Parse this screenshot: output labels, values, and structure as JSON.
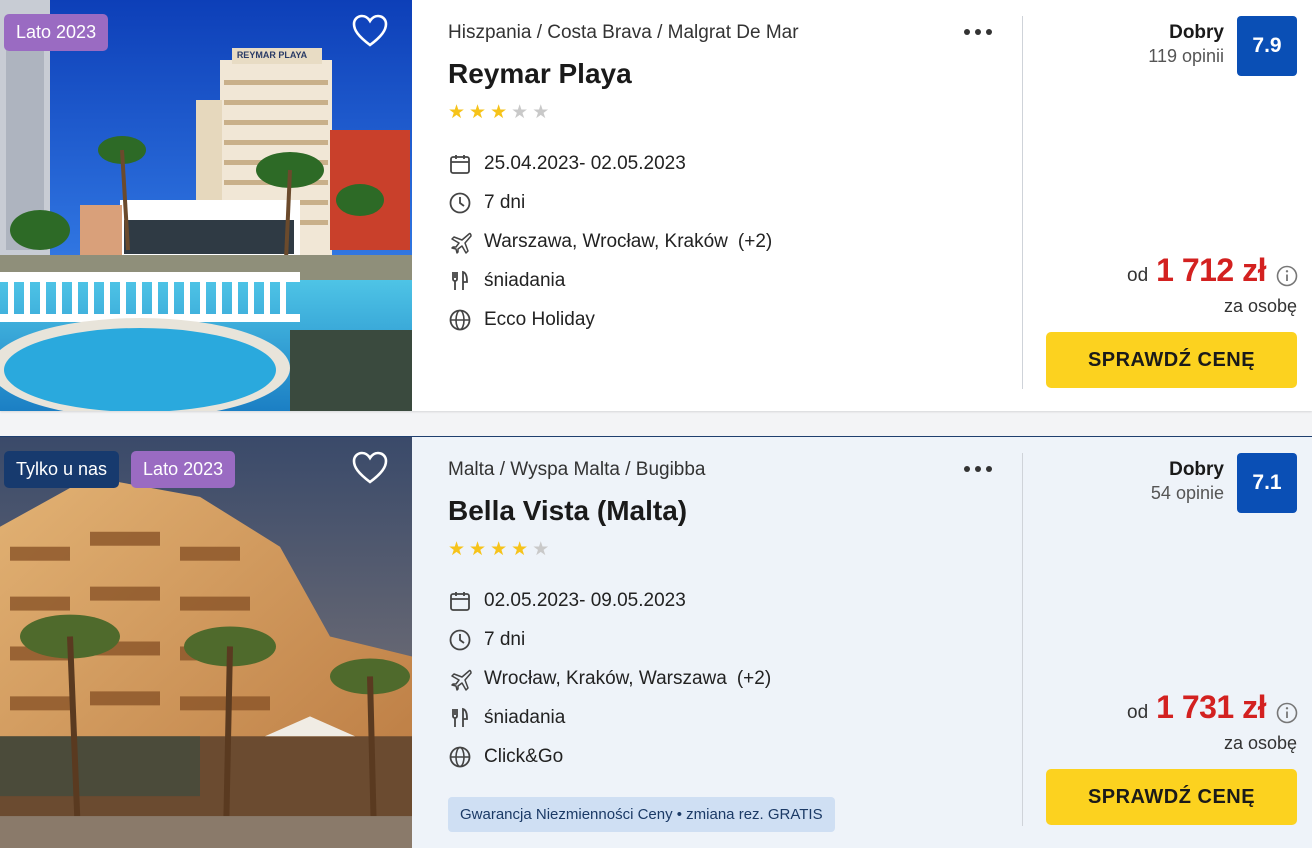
{
  "colors": {
    "rating": "#0a4fb5",
    "price": "#d32120",
    "cta": "#fcd21f",
    "badge_purple": "#9a6bc2",
    "badge_navy": "#173a6e"
  },
  "offers": [
    {
      "badges": [
        "Lato 2023"
      ],
      "breadcrumb": "Hiszpania / Costa Brava / Malgrat De Mar",
      "name": "Reymar Playa",
      "stars": 3,
      "dates": "25.04.2023- 02.05.2023",
      "duration": "7 dni",
      "departures": "Warszawa, Wrocław, Kraków",
      "departures_more": "(+2)",
      "board": "śniadania",
      "operator": "Ecco Holiday",
      "rating_label": "Dobry",
      "rating_count": "119 opinii",
      "rating_score": "7.9",
      "price_prefix": "od",
      "price": "1 712 zł",
      "price_note": "za osobę",
      "cta": "SPRAWDŹ CENĘ",
      "photo_sign": "REYMAR PLAYA"
    },
    {
      "badges": [
        "Tylko u nas",
        "Lato 2023"
      ],
      "breadcrumb": "Malta / Wyspa Malta / Bugibba",
      "name": "Bella Vista (Malta)",
      "stars": 4,
      "dates": "02.05.2023- 09.05.2023",
      "duration": "7 dni",
      "departures": "Wrocław, Kraków, Warszawa",
      "departures_more": "(+2)",
      "board": "śniadania",
      "operator": "Click&Go",
      "guarantee": "Gwarancja Niezmienności Ceny • zmiana rez. GRATIS",
      "rating_label": "Dobry",
      "rating_count": "54 opinie",
      "rating_score": "7.1",
      "price_prefix": "od",
      "price": "1 731 zł",
      "price_note": "za osobę",
      "cta": "SPRAWDŹ CENĘ"
    }
  ]
}
